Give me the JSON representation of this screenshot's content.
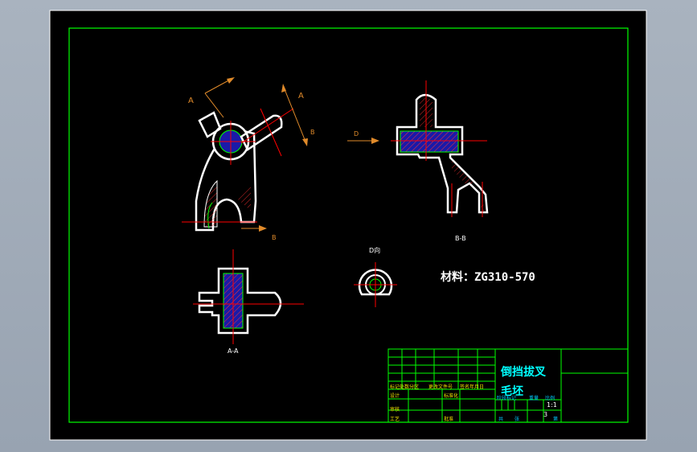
{
  "drawing": {
    "section_labels": {
      "A": "A",
      "B": "B",
      "D": "D",
      "view_bb": "B-B",
      "view_aa": "A-A",
      "view_d": "D向"
    },
    "material_note": "材料：ZG310-570",
    "title_block": {
      "part_name_line1": "倒挡拔叉",
      "part_name_line2": "毛坯",
      "scale": "1:1",
      "sheet": "3",
      "small_labels": [
        "标记处数分区",
        "更改文件号",
        "签名年月日",
        "设计",
        "标准化",
        "审核",
        "工艺",
        "批准",
        "阶段标记",
        "重量",
        "比例",
        "共",
        "张",
        "第"
      ]
    },
    "colors": {
      "background": "#000000",
      "frame": "#00ff00",
      "outline": "#ffffff",
      "centerline": "#ff0000",
      "hatch": "#ff3030",
      "fill": "#1a1aa8",
      "dimension": "#e08a2a",
      "title_text": "#00ffff"
    }
  }
}
